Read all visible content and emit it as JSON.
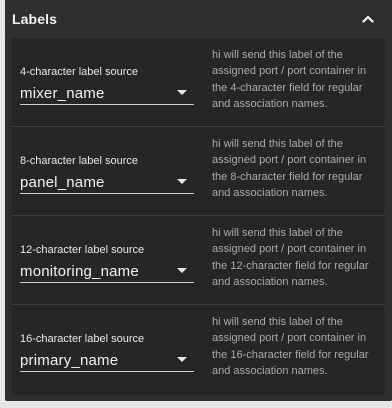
{
  "panel": {
    "title": "Labels"
  },
  "rows": [
    {
      "label": "4-character label source",
      "value": "mixer_name",
      "description": "hi will send this label of the assigned port / port container in the 4-character field for regular and association names."
    },
    {
      "label": "8-character label source",
      "value": "panel_name",
      "description": "hi will send this label of the assigned port / port container in the 8-character field for regular and association names."
    },
    {
      "label": "12-character label source",
      "value": "monitoring_name",
      "description": "hi will send this label of the assigned port / port container in the 12-character field for regular and association names."
    },
    {
      "label": "16-character label source",
      "value": "primary_name",
      "description": "hi will send this label of the assigned port / port container in the 16-character field for regular and association names."
    }
  ],
  "icons": {
    "collapse": "chevron-up-icon",
    "dropdown": "caret-down-icon"
  },
  "colors": {
    "panel_bg": "#2d2d2d",
    "body_bg": "#262626",
    "text": "#f2f2f2",
    "muted_text": "#a9a9a9"
  }
}
